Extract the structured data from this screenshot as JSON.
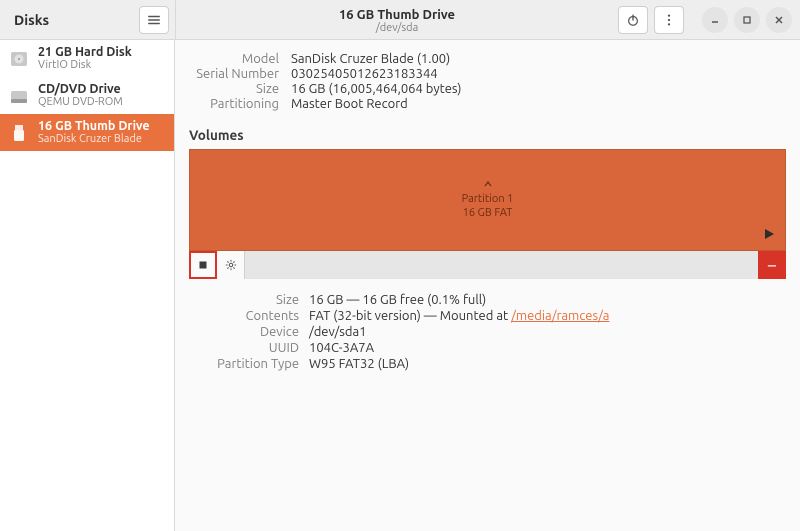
{
  "header": {
    "app_title": "Disks",
    "drive_title": "16 GB Thumb Drive",
    "drive_path": "/dev/sda"
  },
  "sidebar": {
    "items": [
      {
        "label": "21 GB Hard Disk",
        "sub": "VirtIO Disk",
        "icon": "hdd"
      },
      {
        "label": "CD/DVD Drive",
        "sub": "QEMU DVD-ROM",
        "icon": "disc"
      },
      {
        "label": "16 GB Thumb Drive",
        "sub": "SanDisk Cruzer Blade",
        "icon": "usb",
        "selected": true
      }
    ]
  },
  "drive_info": {
    "model_label": "Model",
    "model": "SanDisk Cruzer Blade (1.00)",
    "serial_label": "Serial Number",
    "serial": "03025405012623183344",
    "size_label": "Size",
    "size": "16 GB (16,005,464,064 bytes)",
    "part_label": "Partitioning",
    "part": "Master Boot Record"
  },
  "volumes": {
    "section_title": "Volumes",
    "partition_caption_line1": "Partition 1",
    "partition_caption_line2": "16 GB FAT"
  },
  "toolbar": {
    "delete_glyph": "−"
  },
  "partition_info": {
    "size_label": "Size",
    "size": "16 GB — 16 GB free (0.1% full)",
    "contents_label": "Contents",
    "contents_prefix": "FAT (32-bit version) — Mounted at ",
    "contents_link": "/media/ramces/a",
    "device_label": "Device",
    "device": "/dev/sda1",
    "uuid_label": "UUID",
    "uuid": "104C-3A7A",
    "ptype_label": "Partition Type",
    "ptype": "W95 FAT32 (LBA)"
  }
}
